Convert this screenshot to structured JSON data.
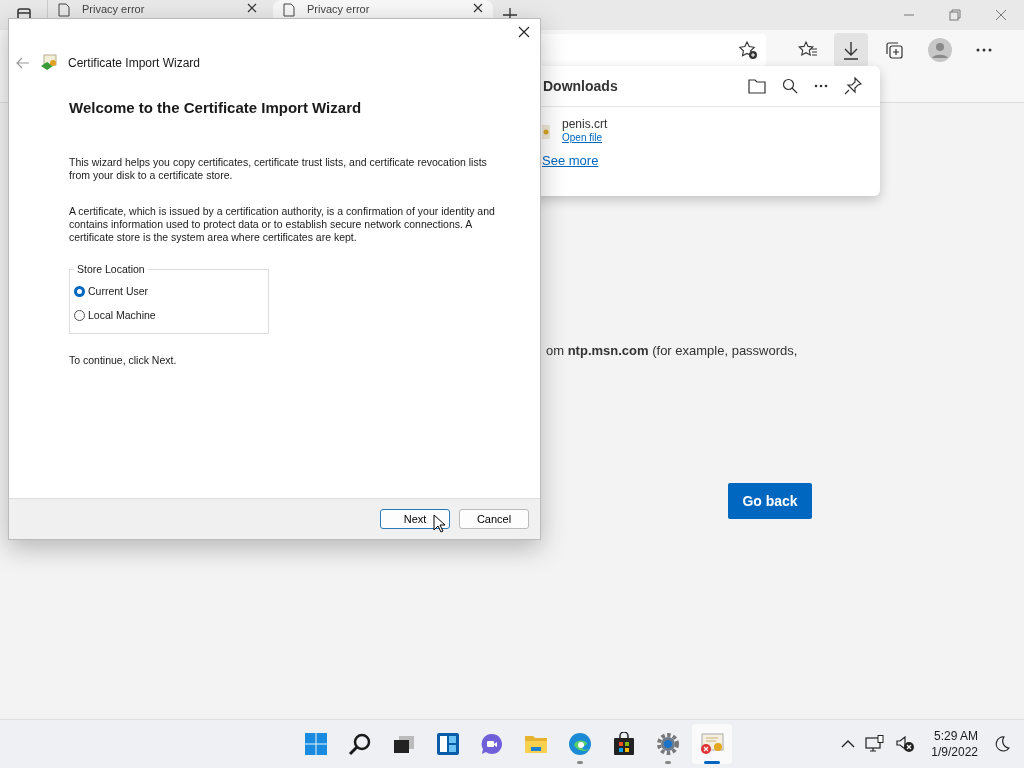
{
  "browser": {
    "tabs": [
      {
        "title": "Privacy error",
        "selected": false
      },
      {
        "title": "Privacy error",
        "selected": true
      }
    ],
    "downloads_panel": {
      "title": "Downloads",
      "items": [
        {
          "file_name": "penis.crt",
          "action": "Open file"
        }
      ],
      "see_more": "See more"
    },
    "page": {
      "text": "om **ntp.msn.com** (for example, passwords,",
      "go_back_button": "Go back"
    }
  },
  "dialog": {
    "title": "Certificate Import Wizard",
    "heading": "Welcome to the Certificate Import Wizard",
    "paragraphs": [
      "This wizard helps you copy certificates, certificate trust lists, and certificate revocation lists from your disk to a certificate store.",
      "A certificate, which is issued by a certification authority, is a confirmation of your identity and contains information used to protect data or to establish secure network connections. A certificate store is the system area where certificates are kept."
    ],
    "store_location": {
      "label": "Store Location",
      "options": [
        {
          "label": "Current User",
          "selected": true
        },
        {
          "label": "Local Machine",
          "selected": false
        }
      ]
    },
    "instruction": "To continue, click Next.",
    "buttons": [
      {
        "label": "Next",
        "focused": true
      },
      {
        "label": "Cancel",
        "focused": false
      }
    ]
  },
  "taskbar": {
    "apps": [
      {
        "kind": "start",
        "running": false,
        "active": false
      },
      {
        "kind": "search",
        "running": false,
        "active": false
      },
      {
        "kind": "task-view",
        "running": false,
        "active": false
      },
      {
        "kind": "widgets",
        "running": false,
        "active": false
      },
      {
        "kind": "chat",
        "running": false,
        "active": false
      },
      {
        "kind": "explorer",
        "running": false,
        "active": false
      },
      {
        "kind": "edge",
        "running": true,
        "active": false
      },
      {
        "kind": "store",
        "running": false,
        "active": false
      },
      {
        "kind": "settings",
        "running": true,
        "active": false
      },
      {
        "kind": "certificate",
        "running": true,
        "active": true
      }
    ],
    "time": "5:29 AM",
    "date": "1/9/2022"
  }
}
